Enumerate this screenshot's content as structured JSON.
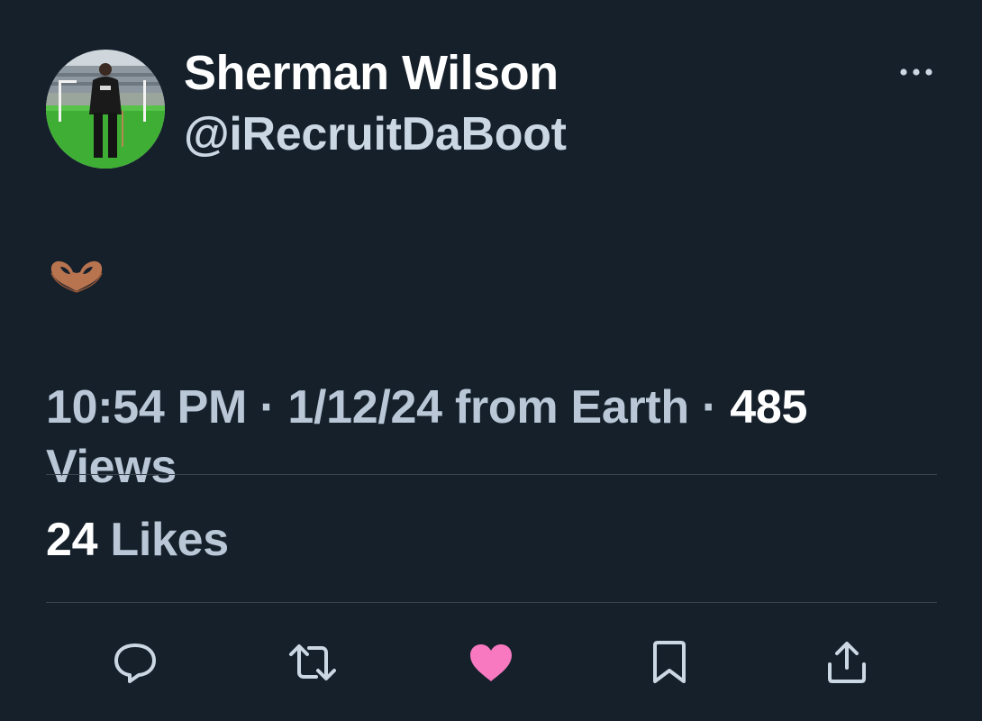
{
  "author": {
    "display_name": "Sherman Wilson",
    "handle": "@iRecruitDaBoot",
    "avatar_icon": "avatar-photo"
  },
  "menu": {
    "more_icon": "more-horizontal-icon"
  },
  "tweet": {
    "text_icon": "heart-hands-emoji"
  },
  "meta": {
    "time": "10:54 PM",
    "separator": "·",
    "date": "1/12/24",
    "source": "from Earth",
    "views_count": "485",
    "views_label": "Views"
  },
  "stats": {
    "likes_count": "24",
    "likes_label": "Likes"
  },
  "actions": {
    "reply_icon": "reply-icon",
    "retweet_icon": "retweet-icon",
    "like_icon": "heart-icon",
    "bookmark_icon": "bookmark-icon",
    "share_icon": "share-icon"
  },
  "colors": {
    "background": "#15202b",
    "primary_text": "#ffffff",
    "secondary_text": "#b9c7d6",
    "divider": "#38444d",
    "like_active": "#f91880"
  }
}
